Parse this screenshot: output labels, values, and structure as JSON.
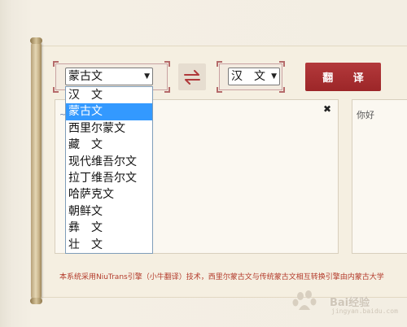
{
  "source_language": {
    "selected": "蒙古文",
    "options": [
      "汉　文",
      "蒙古文",
      "西里尔蒙文",
      "藏　文",
      "现代维吾尔文",
      "拉丁维吾尔文",
      "哈萨克文",
      "朝鲜文",
      "彝　文",
      "壮　文"
    ],
    "highlighted_index": 1
  },
  "target_language": {
    "selected": "汉　文"
  },
  "swap_icon": "swap-arrows-icon",
  "translate_button": {
    "label": "翻 译"
  },
  "source_panel": {
    "close_glyph": "✖"
  },
  "target_panel": {
    "text": "你好"
  },
  "footer_note": "本系统采用NiuTrans引擎（小牛翻译）技术，西里尔蒙古文与传统蒙古文相互转换引擎由内蒙古大学",
  "watermark": {
    "text": "Bai经验",
    "sub": "jingyan.baidu.com"
  },
  "colors": {
    "accent": "#a62e30",
    "highlight": "#3399ff",
    "note": "#b33a2a"
  }
}
